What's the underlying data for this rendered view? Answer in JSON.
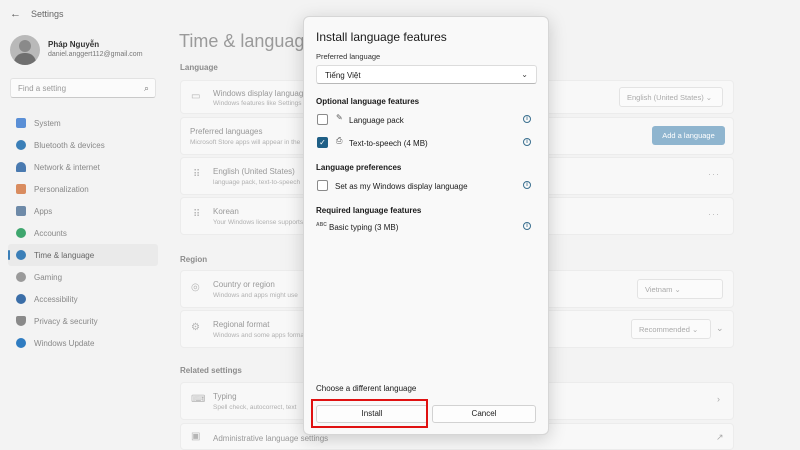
{
  "window": {
    "title": "Settings",
    "back_glyph": "←"
  },
  "profile": {
    "name": "Pháp Nguyễn",
    "email": "daniel.anggert112@gmail.com"
  },
  "search": {
    "placeholder": "Find a setting",
    "icon": "search-icon"
  },
  "sidebar": {
    "items": [
      {
        "label": "System",
        "icon": "monitor-icon",
        "color": "#5a8fd6"
      },
      {
        "label": "Bluetooth & devices",
        "icon": "bluetooth-icon",
        "color": "#3b7fb8"
      },
      {
        "label": "Network & internet",
        "icon": "wifi-icon",
        "color": "#4a7ab0"
      },
      {
        "label": "Personalization",
        "icon": "brush-icon",
        "color": "#d98c5f"
      },
      {
        "label": "Apps",
        "icon": "apps-icon",
        "color": "#6e8aa8"
      },
      {
        "label": "Accounts",
        "icon": "person-icon",
        "color": "#3ea66e"
      },
      {
        "label": "Time & language",
        "icon": "globe-clock-icon",
        "color": "#3b7fb8",
        "active": true
      },
      {
        "label": "Gaming",
        "icon": "gamepad-icon",
        "color": "#8a8a8a"
      },
      {
        "label": "Accessibility",
        "icon": "accessibility-icon",
        "color": "#3b6ea8"
      },
      {
        "label": "Privacy & security",
        "icon": "shield-icon",
        "color": "#8a8a8a"
      },
      {
        "label": "Windows Update",
        "icon": "update-icon",
        "color": "#2f7cc1"
      }
    ]
  },
  "main": {
    "title": "Time & language",
    "language_section": "Language",
    "display_language": {
      "title": "Windows display language",
      "sub": "Windows features like Settings",
      "value": "English (United States)"
    },
    "preferred": {
      "title": "Preferred languages",
      "sub": "Microsoft Store apps will appear in the",
      "add_button": "Add a language"
    },
    "lang_english": {
      "title": "English (United States)",
      "sub": "language pack, text-to-speech"
    },
    "lang_korean": {
      "title": "Korean",
      "sub": "Your Windows license supports"
    },
    "region_section": "Region",
    "country": {
      "title": "Country or region",
      "sub": "Windows and apps might use",
      "value": "Vietnam"
    },
    "regional_format": {
      "title": "Regional format",
      "sub": "Windows and some apps format",
      "value": "Recommended"
    },
    "related_section": "Related settings",
    "typing": {
      "title": "Typing",
      "sub": "Spell check, autocorrect, text"
    },
    "admin": {
      "title": "Administrative language settings"
    },
    "more_glyph": "···",
    "chevron_glyph": "⌄",
    "right_chevron_glyph": "›",
    "external_glyph": "↗"
  },
  "dialog": {
    "title": "Install language features",
    "preferred_label": "Preferred language",
    "preferred_value": "Tiếng Việt",
    "optional_head": "Optional language features",
    "options": [
      {
        "label": "Language pack",
        "checked": false
      },
      {
        "label": "Text-to-speech (4 MB)",
        "checked": true
      }
    ],
    "prefs_head": "Language preferences",
    "pref_option": {
      "label": "Set as my Windows display language",
      "checked": false
    },
    "required_head": "Required language features",
    "required_item": "Basic typing (3 MB)",
    "abc_label": "ABC",
    "choose_different": "Choose a different language",
    "install_label": "Install",
    "cancel_label": "Cancel",
    "highlight_color": "#e01111"
  }
}
